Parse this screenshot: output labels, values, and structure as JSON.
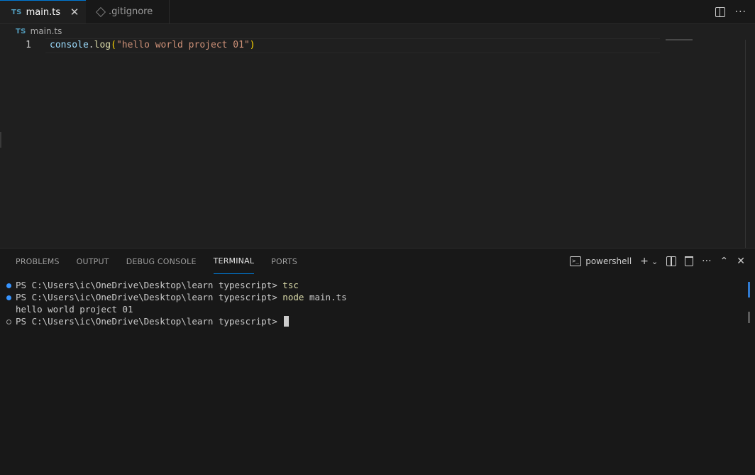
{
  "tabs": [
    {
      "badge": "TS",
      "label": "main.ts",
      "close": "✕"
    },
    {
      "label": ".gitignore"
    }
  ],
  "tab_actions": {
    "more": "···"
  },
  "breadcrumb": {
    "badge": "TS",
    "file": "main.ts"
  },
  "editor": {
    "line_number": "1",
    "code": {
      "obj": "console",
      "dot": ".",
      "fn": "log",
      "open": "(",
      "str": "\"hello world project 01\"",
      "close": ")"
    }
  },
  "panel": {
    "tabs": [
      "PROBLEMS",
      "OUTPUT",
      "DEBUG CONSOLE",
      "TERMINAL",
      "PORTS"
    ],
    "active_tab": "TERMINAL",
    "shell": "powershell",
    "icons": {
      "plus": "+",
      "chevron": "⌄",
      "more": "···",
      "up": "⌃",
      "close": "✕"
    }
  },
  "terminal": {
    "prompt": "PS C:\\Users\\ic\\OneDrive\\Desktop\\learn typescript> ",
    "lines": [
      {
        "cmd": "tsc",
        "args": ""
      },
      {
        "cmd": "node",
        "args": " main.ts"
      }
    ],
    "output": "hello world project 01"
  },
  "colors": {
    "accent": "#0078d4",
    "ts_badge": "#519aba",
    "decoration_dot": "#3794ff"
  }
}
